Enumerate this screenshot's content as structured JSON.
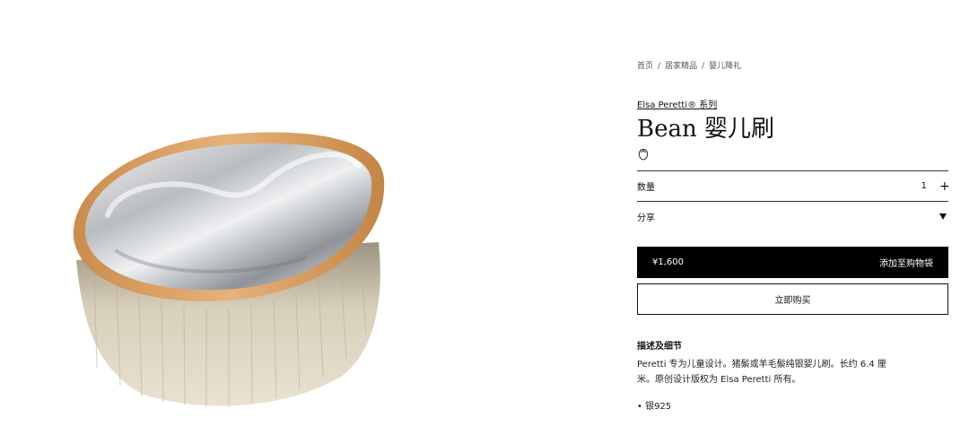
{
  "breadcrumb": {
    "items": [
      "首页",
      "居家精品",
      "婴儿降礼"
    ],
    "separator": "/"
  },
  "product": {
    "collection": "Elsa Peretti® 系列",
    "title": "Bean 婴儿刷",
    "image_alt": "Bean baby brush"
  },
  "quantity": {
    "label": "数量",
    "value": "1",
    "increment": "+"
  },
  "share": {
    "label": "分享"
  },
  "actions": {
    "price": "¥1,600",
    "add_to_bag": "添加至购物袋",
    "buy_now": "立即购买"
  },
  "description": {
    "heading": "描述及细节",
    "text": "Peretti 专为儿童设计。猪鬃或羊毛鬃纯银婴儿刷。长约 6.4 厘米。原创设计版权为 Elsa Peretti 所有。",
    "bullet": "• 银925"
  },
  "colors": {
    "primary": "#000000",
    "text": "#111111",
    "border": "#333333"
  },
  "icons": {
    "engrave": "engrave-icon",
    "share_toggle": "caret-down-icon"
  }
}
